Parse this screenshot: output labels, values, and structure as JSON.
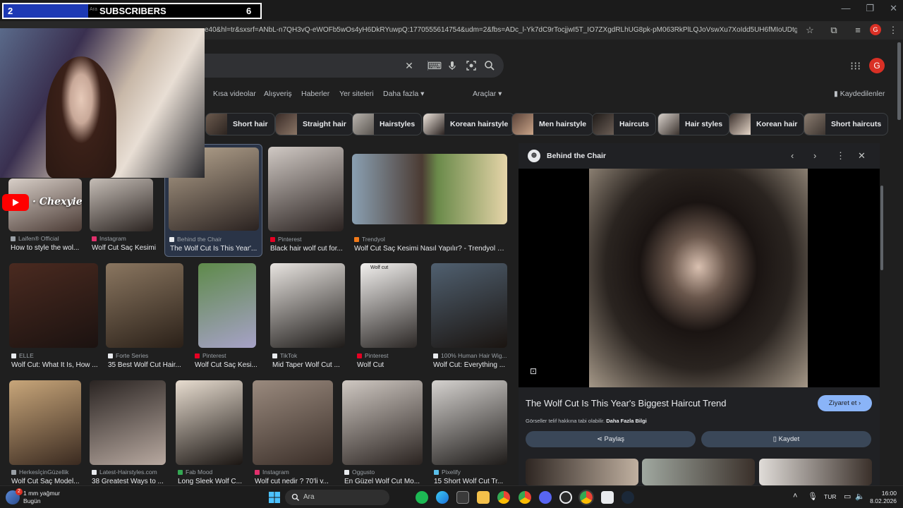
{
  "overlay": {
    "subs_count_left": "2",
    "subs_small": "Ara",
    "subs_label": "SUBSCRIBERS",
    "subs_count_right": "6",
    "channel_name": "Chexyie"
  },
  "browser": {
    "url": "e40&hl=tr&sxsrf=ANbL-n7QH3vQ-eWOFb5wOs4yH6DkRYuwpQ:1770555614754&udm=2&fbs=ADc_l-Yk7dC9rTocjjwI5T_IO7ZXgdRLhUG8pk-pM063RkPlLQJoVswXu7XoIdd5UH6fMIoUDtgozPElNwZYSjs_...",
    "avatar_letter": "G",
    "window_controls": [
      "—",
      "❐",
      "✕"
    ]
  },
  "google": {
    "avatar_letter": "G",
    "nav_tabs": [
      "Kısa videolar",
      "Alışveriş",
      "Haberler",
      "Yer siteleri",
      "Daha fazla ▾",
      "Araçlar ▾"
    ],
    "saved_label": "Kaydedilenler",
    "chips": [
      "Short hair",
      "Straight hair",
      "Hairstyles",
      "Korean hairstyle",
      "Men hairstyle",
      "Haircuts",
      "Hair styles",
      "Korean hair",
      "Short haircuts"
    ],
    "results": [
      {
        "source": "Laifen® Official",
        "title": "How to style the wol..."
      },
      {
        "source": "Instagram",
        "title": "Wolf Cut Saç Kesimi"
      },
      {
        "source": "Behind the Chair",
        "title": "The Wolf Cut Is This Year'..."
      },
      {
        "source": "Pinterest",
        "title": "Black hair wolf cut for..."
      },
      {
        "source": "Trendyol",
        "title": "Wolf Cut Saç Kesimi Nasıl Yapılır? - Trendyol Bl..."
      },
      {
        "source": "ELLE",
        "title": "Wolf Cut: What It Is, How ..."
      },
      {
        "source": "Forte Series",
        "title": "35 Best Wolf Cut Hair..."
      },
      {
        "source": "Pinterest",
        "title": "Wolf Cut Saç Kesi..."
      },
      {
        "source": "TikTok",
        "title": "Mid Taper Wolf Cut ..."
      },
      {
        "source": "Pinterest",
        "title": "Wolf Cut"
      },
      {
        "source": "100% Human Hair Wig...",
        "title": "Wolf Cut: Everything ..."
      },
      {
        "source": "HerkesİçinGüzellik",
        "title": "Wolf Cut Saç Model..."
      },
      {
        "source": "Latest-Hairstyles.com",
        "title": "38 Greatest Ways to ..."
      },
      {
        "source": "Fab Mood",
        "title": "Long Sleek Wolf C..."
      },
      {
        "source": "Instagram",
        "title": "Wolf cut nedir ? 70'li v..."
      },
      {
        "source": "Oggusto",
        "title": "En Güzel Wolf Cut Mo..."
      },
      {
        "source": "Pixelify",
        "title": "15 Short Wolf Cut Tr..."
      }
    ],
    "image_overlay_text": "Wolf cut"
  },
  "panel": {
    "source": "Behind the Chair",
    "title": "The Wolf Cut Is This Year's Biggest Haircut Trend",
    "visit_label": "Ziyaret et ›",
    "copyright": "Görseller telif hakkına tabi olabilir.",
    "more_info": "Daha Fazla Bilgi",
    "share_label": "Paylaş",
    "save_label": "Kaydet"
  },
  "taskbar": {
    "weather_temp": "1 mm yağmur",
    "weather_day": "Bugün",
    "search_placeholder": "Ara",
    "lang": "TUR",
    "time": "16:00",
    "date": "8.02.2026",
    "badge_count": "2"
  }
}
